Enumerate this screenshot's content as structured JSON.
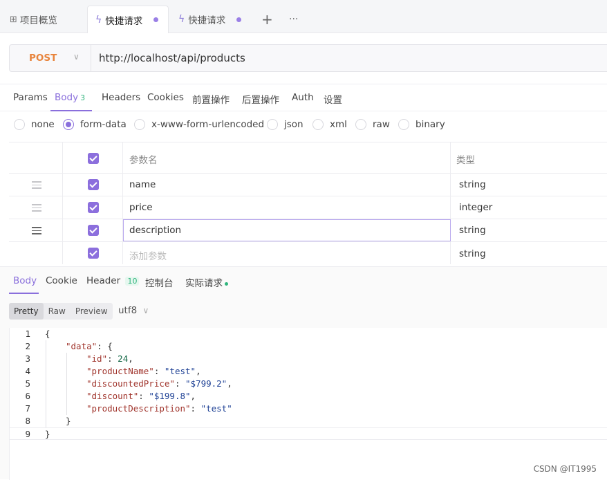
{
  "tabs": [
    {
      "label": "项目概览",
      "icon": "grid-icon"
    },
    {
      "label": "快捷请求",
      "icon": "bolt-icon",
      "active": true
    },
    {
      "label": "快捷请求",
      "icon": "bolt-icon"
    }
  ],
  "tab_actions": {
    "add": "+",
    "more": "···"
  },
  "request": {
    "method": "POST",
    "url": "http://localhost/api/products"
  },
  "request_tabs": [
    {
      "label": "Params"
    },
    {
      "label": "Body",
      "badge": "3",
      "active": true
    },
    {
      "label": "Headers"
    },
    {
      "label": "Cookies"
    },
    {
      "label": "前置操作"
    },
    {
      "label": "后置操作"
    },
    {
      "label": "Auth"
    },
    {
      "label": "设置"
    }
  ],
  "body_types": [
    {
      "label": "none"
    },
    {
      "label": "form-data",
      "selected": true
    },
    {
      "label": "x-www-form-urlencoded"
    },
    {
      "label": "json"
    },
    {
      "label": "xml"
    },
    {
      "label": "raw"
    },
    {
      "label": "binary"
    }
  ],
  "params_table": {
    "headers": {
      "name": "参数名",
      "type": "类型"
    },
    "rows": [
      {
        "name": "name",
        "type": "string",
        "checked": true
      },
      {
        "name": "price",
        "type": "integer",
        "checked": true
      },
      {
        "name": "description",
        "type": "string",
        "checked": true,
        "focused": true
      },
      {
        "name": "",
        "placeholder": "添加参数",
        "type": "string",
        "checked": true
      }
    ]
  },
  "response_tabs": [
    {
      "label": "Body",
      "active": true
    },
    {
      "label": "Cookie"
    },
    {
      "label": "Header",
      "badge": "10"
    },
    {
      "label": "控制台"
    },
    {
      "label": "实际请求",
      "dot": true
    }
  ],
  "view_modes": [
    {
      "label": "Pretty",
      "active": true
    },
    {
      "label": "Raw"
    },
    {
      "label": "Preview"
    }
  ],
  "encoding": "utf8",
  "code_lines": [
    {
      "n": "1",
      "text": "{"
    },
    {
      "n": "2",
      "key": "\"data\"",
      "rest": ": {"
    },
    {
      "n": "3",
      "key": "\"id\"",
      "rest": ": ",
      "num": "24",
      "tail": ","
    },
    {
      "n": "4",
      "key": "\"productName\"",
      "rest": ": ",
      "str": "\"test\"",
      "tail": ","
    },
    {
      "n": "5",
      "key": "\"discountedPrice\"",
      "rest": ": ",
      "str": "\"$799.2\"",
      "tail": ","
    },
    {
      "n": "6",
      "key": "\"discount\"",
      "rest": ": ",
      "str": "\"$199.8\"",
      "tail": ","
    },
    {
      "n": "7",
      "key": "\"productDescription\"",
      "rest": ": ",
      "str": "\"test\""
    },
    {
      "n": "8",
      "text": "}"
    },
    {
      "n": "9",
      "text": "}"
    }
  ],
  "watermark": "CSDN @IT1995",
  "colors": {
    "accent": "#8a6fdc",
    "method": "#e8843c",
    "success": "#2fb47c"
  }
}
